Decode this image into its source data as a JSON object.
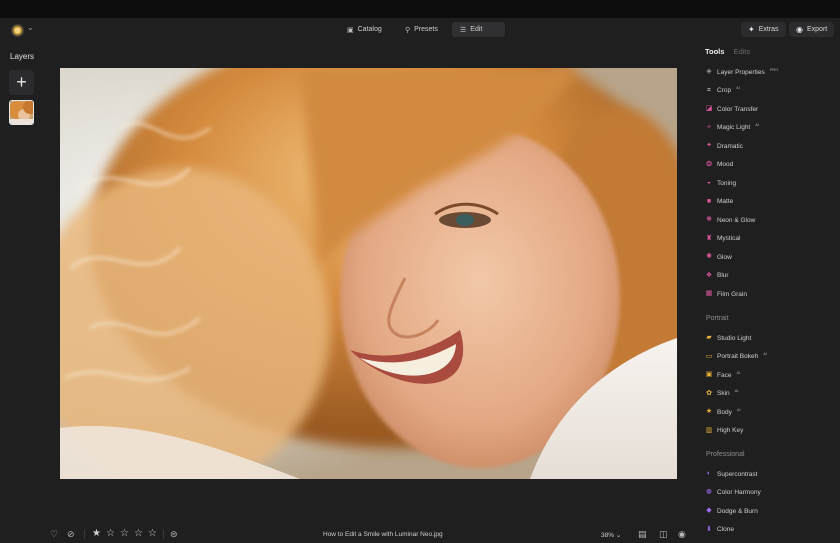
{
  "header": {
    "tabs": [
      {
        "label": "Catalog",
        "icon": "folder-icon"
      },
      {
        "label": "Presets",
        "icon": "search-icon"
      },
      {
        "label": "Edit",
        "icon": "sliders-icon"
      }
    ],
    "extras_label": "Extras",
    "export_label": "Export"
  },
  "layers": {
    "title": "Layers",
    "add_symbol": "+"
  },
  "panel": {
    "tab_tools": "Tools",
    "tab_edits": "Edits",
    "tools": [
      {
        "label": "Layer Properties",
        "badge": "PRO",
        "color": "#9a9a9a"
      },
      {
        "label": "Crop",
        "badge": "AI",
        "color": "#cfcfcf"
      },
      {
        "label": "Color Transfer",
        "badge": "",
        "color": "#e0569c"
      },
      {
        "label": "Magic Light",
        "badge": "AI",
        "color": "#e0569c"
      },
      {
        "label": "Dramatic",
        "badge": "",
        "color": "#e0569c"
      },
      {
        "label": "Mood",
        "badge": "",
        "color": "#e0569c"
      },
      {
        "label": "Toning",
        "badge": "",
        "color": "#e0569c"
      },
      {
        "label": "Matte",
        "badge": "",
        "color": "#e0569c"
      },
      {
        "label": "Neon & Glow",
        "badge": "",
        "color": "#e0569c"
      },
      {
        "label": "Mystical",
        "badge": "",
        "color": "#e0569c"
      },
      {
        "label": "Glow",
        "badge": "",
        "color": "#e0569c"
      },
      {
        "label": "Blur",
        "badge": "",
        "color": "#e0569c"
      },
      {
        "label": "Film Grain",
        "badge": "",
        "color": "#e0569c"
      }
    ],
    "portrait_title": "Portrait",
    "portrait": [
      {
        "label": "Studio Light",
        "badge": "",
        "color": "#e8b23a"
      },
      {
        "label": "Portrait Bokeh",
        "badge": "AI",
        "color": "#e8b23a"
      },
      {
        "label": "Face",
        "badge": "AI",
        "color": "#e8b23a"
      },
      {
        "label": "Skin",
        "badge": "AI",
        "color": "#e8b23a"
      },
      {
        "label": "Body",
        "badge": "AI",
        "color": "#e8b23a"
      },
      {
        "label": "High Key",
        "badge": "",
        "color": "#e8b23a"
      }
    ],
    "professional_title": "Professional",
    "professional": [
      {
        "label": "Supercontrast",
        "badge": "",
        "color": "#9b6cf0"
      },
      {
        "label": "Color Harmony",
        "badge": "",
        "color": "#9b6cf0"
      },
      {
        "label": "Dodge & Burn",
        "badge": "",
        "color": "#9b6cf0"
      },
      {
        "label": "Clone",
        "badge": "",
        "color": "#9b6cf0"
      }
    ]
  },
  "footer": {
    "filename": "How to Edit a Smile with Luminar Neo.jpg",
    "zoom": "38%",
    "rating": 1,
    "max_rating": 5
  }
}
